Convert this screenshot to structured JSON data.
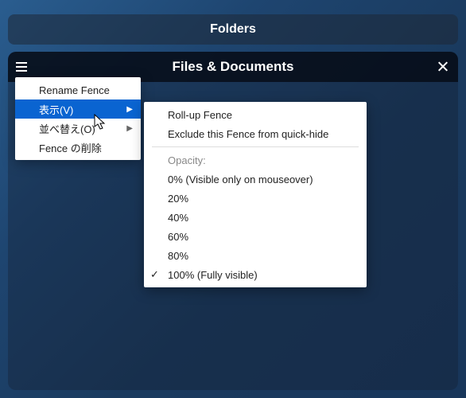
{
  "folders_bar": {
    "label": "Folders"
  },
  "fence": {
    "title": "Files & Documents"
  },
  "context_menu_primary": {
    "items": [
      {
        "label": "Rename Fence",
        "submenu": false
      },
      {
        "label": "表示(V)",
        "submenu": true,
        "highlighted": true
      },
      {
        "label": "並べ替え(O)",
        "submenu": true
      },
      {
        "label": "Fence の削除",
        "submenu": false
      }
    ]
  },
  "context_menu_view": {
    "items": [
      {
        "label": "Roll-up Fence"
      },
      {
        "label": "Exclude this Fence from quick-hide"
      }
    ],
    "opacity_header": "Opacity:",
    "opacity_items": [
      {
        "label": "0% (Visible only on mouseover)",
        "checked": false
      },
      {
        "label": "20%",
        "checked": false
      },
      {
        "label": "40%",
        "checked": false
      },
      {
        "label": "60%",
        "checked": false
      },
      {
        "label": "80%",
        "checked": false
      },
      {
        "label": "100% (Fully visible)",
        "checked": true
      }
    ]
  }
}
